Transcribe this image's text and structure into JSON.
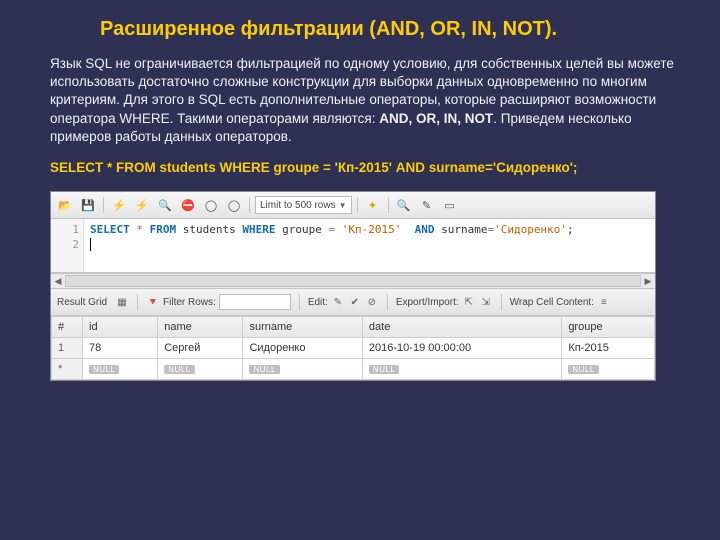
{
  "title": "Расширенное фильтрации (AND, OR, IN, NOT).",
  "paragraph": {
    "p1": "Язык SQL не ограничивается фильтрацией по одному условию, для собственных целей вы можете использовать достаточно сложные конструкции для выборки данных одновременно по многим критериям. Для этого в SQL есть дополнительные операторы, которые расширяют возможности оператора WHERE. Такими операторами являются: ",
    "ops": "AND, OR, IN, NOT",
    "p2": ". Приведем несколько примеров работы данных операторов."
  },
  "query_line": "SELECT * FROM students WHERE groupe = 'Кп-2015'  AND surname='Сидоренко';",
  "editor": {
    "limit_label": "Limit to 500 rows",
    "gutter": {
      "l1": "1",
      "l2": "2"
    },
    "sql": {
      "select": "SELECT",
      "star": "*",
      "from": "FROM",
      "tbl": "students",
      "where": "WHERE",
      "c1": "groupe",
      "eq": "=",
      "v1": "'Кп-2015'",
      "and": "AND",
      "c2": "surname",
      "v2": "'Сидоренко'",
      "semi": ";"
    }
  },
  "midbar": {
    "result_grid": "Result Grid",
    "filter_label": "Filter Rows:",
    "edit": "Edit:",
    "export": "Export/Import:",
    "wrap": "Wrap Cell Content:"
  },
  "table": {
    "headers": {
      "hash": "#",
      "id": "id",
      "name": "name",
      "surname": "surname",
      "date": "date",
      "groupe": "groupe"
    },
    "row1": {
      "num": "1",
      "id": "78",
      "name": "Сергей",
      "surname": "Сидоренко",
      "date": "2016-10-19 00:00:00",
      "groupe": "Кп-2015"
    },
    "nulltext": "NULL",
    "star": "*"
  }
}
